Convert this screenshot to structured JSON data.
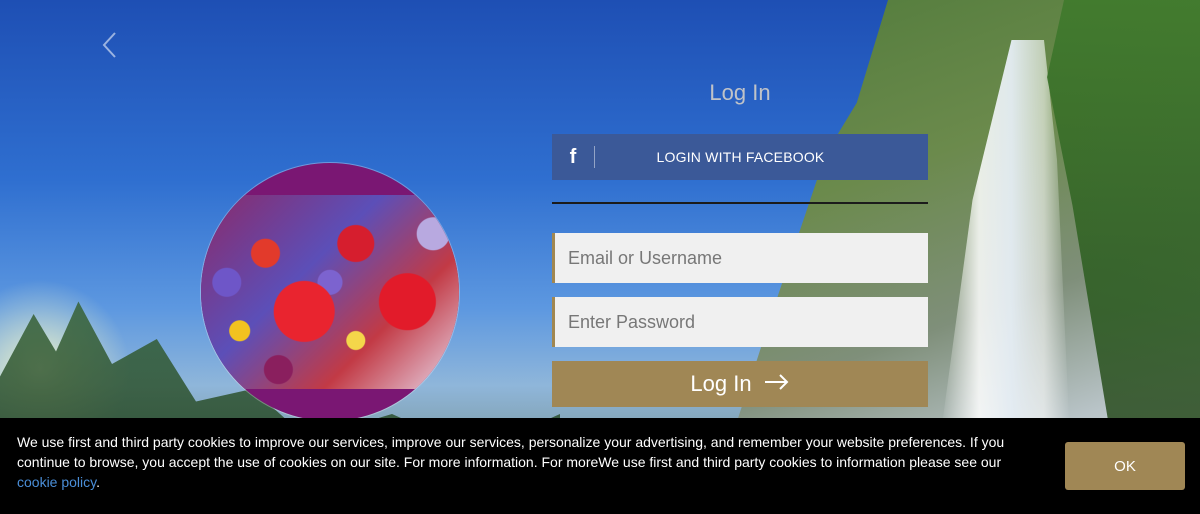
{
  "nav": {
    "back_icon": "chevron-left-icon"
  },
  "login": {
    "title": "Log In",
    "facebook_label": "LOGIN WITH FACEBOOK",
    "facebook_icon": "facebook-icon",
    "facebook_glyph": "f",
    "email_placeholder": "Email or Username",
    "password_placeholder": "Enter Password",
    "submit_label": "Log In",
    "submit_icon": "arrow-right-icon"
  },
  "cookie": {
    "text": "We use first and third party cookies to improve our services, improve our services, personalize your advertising, and remember your website preferences. If you continue to browse, you accept the use of cookies on our site. For more information. For moreWe use first and third party cookies to information please see our",
    "link_label": "cookie policy",
    "link_suffix": ".",
    "ok_label": "OK"
  },
  "colors": {
    "facebook_blue": "#3b5998",
    "accent_gold": "#a08755",
    "cookie_bar": "#000000",
    "link_blue": "#4a8ed8"
  }
}
